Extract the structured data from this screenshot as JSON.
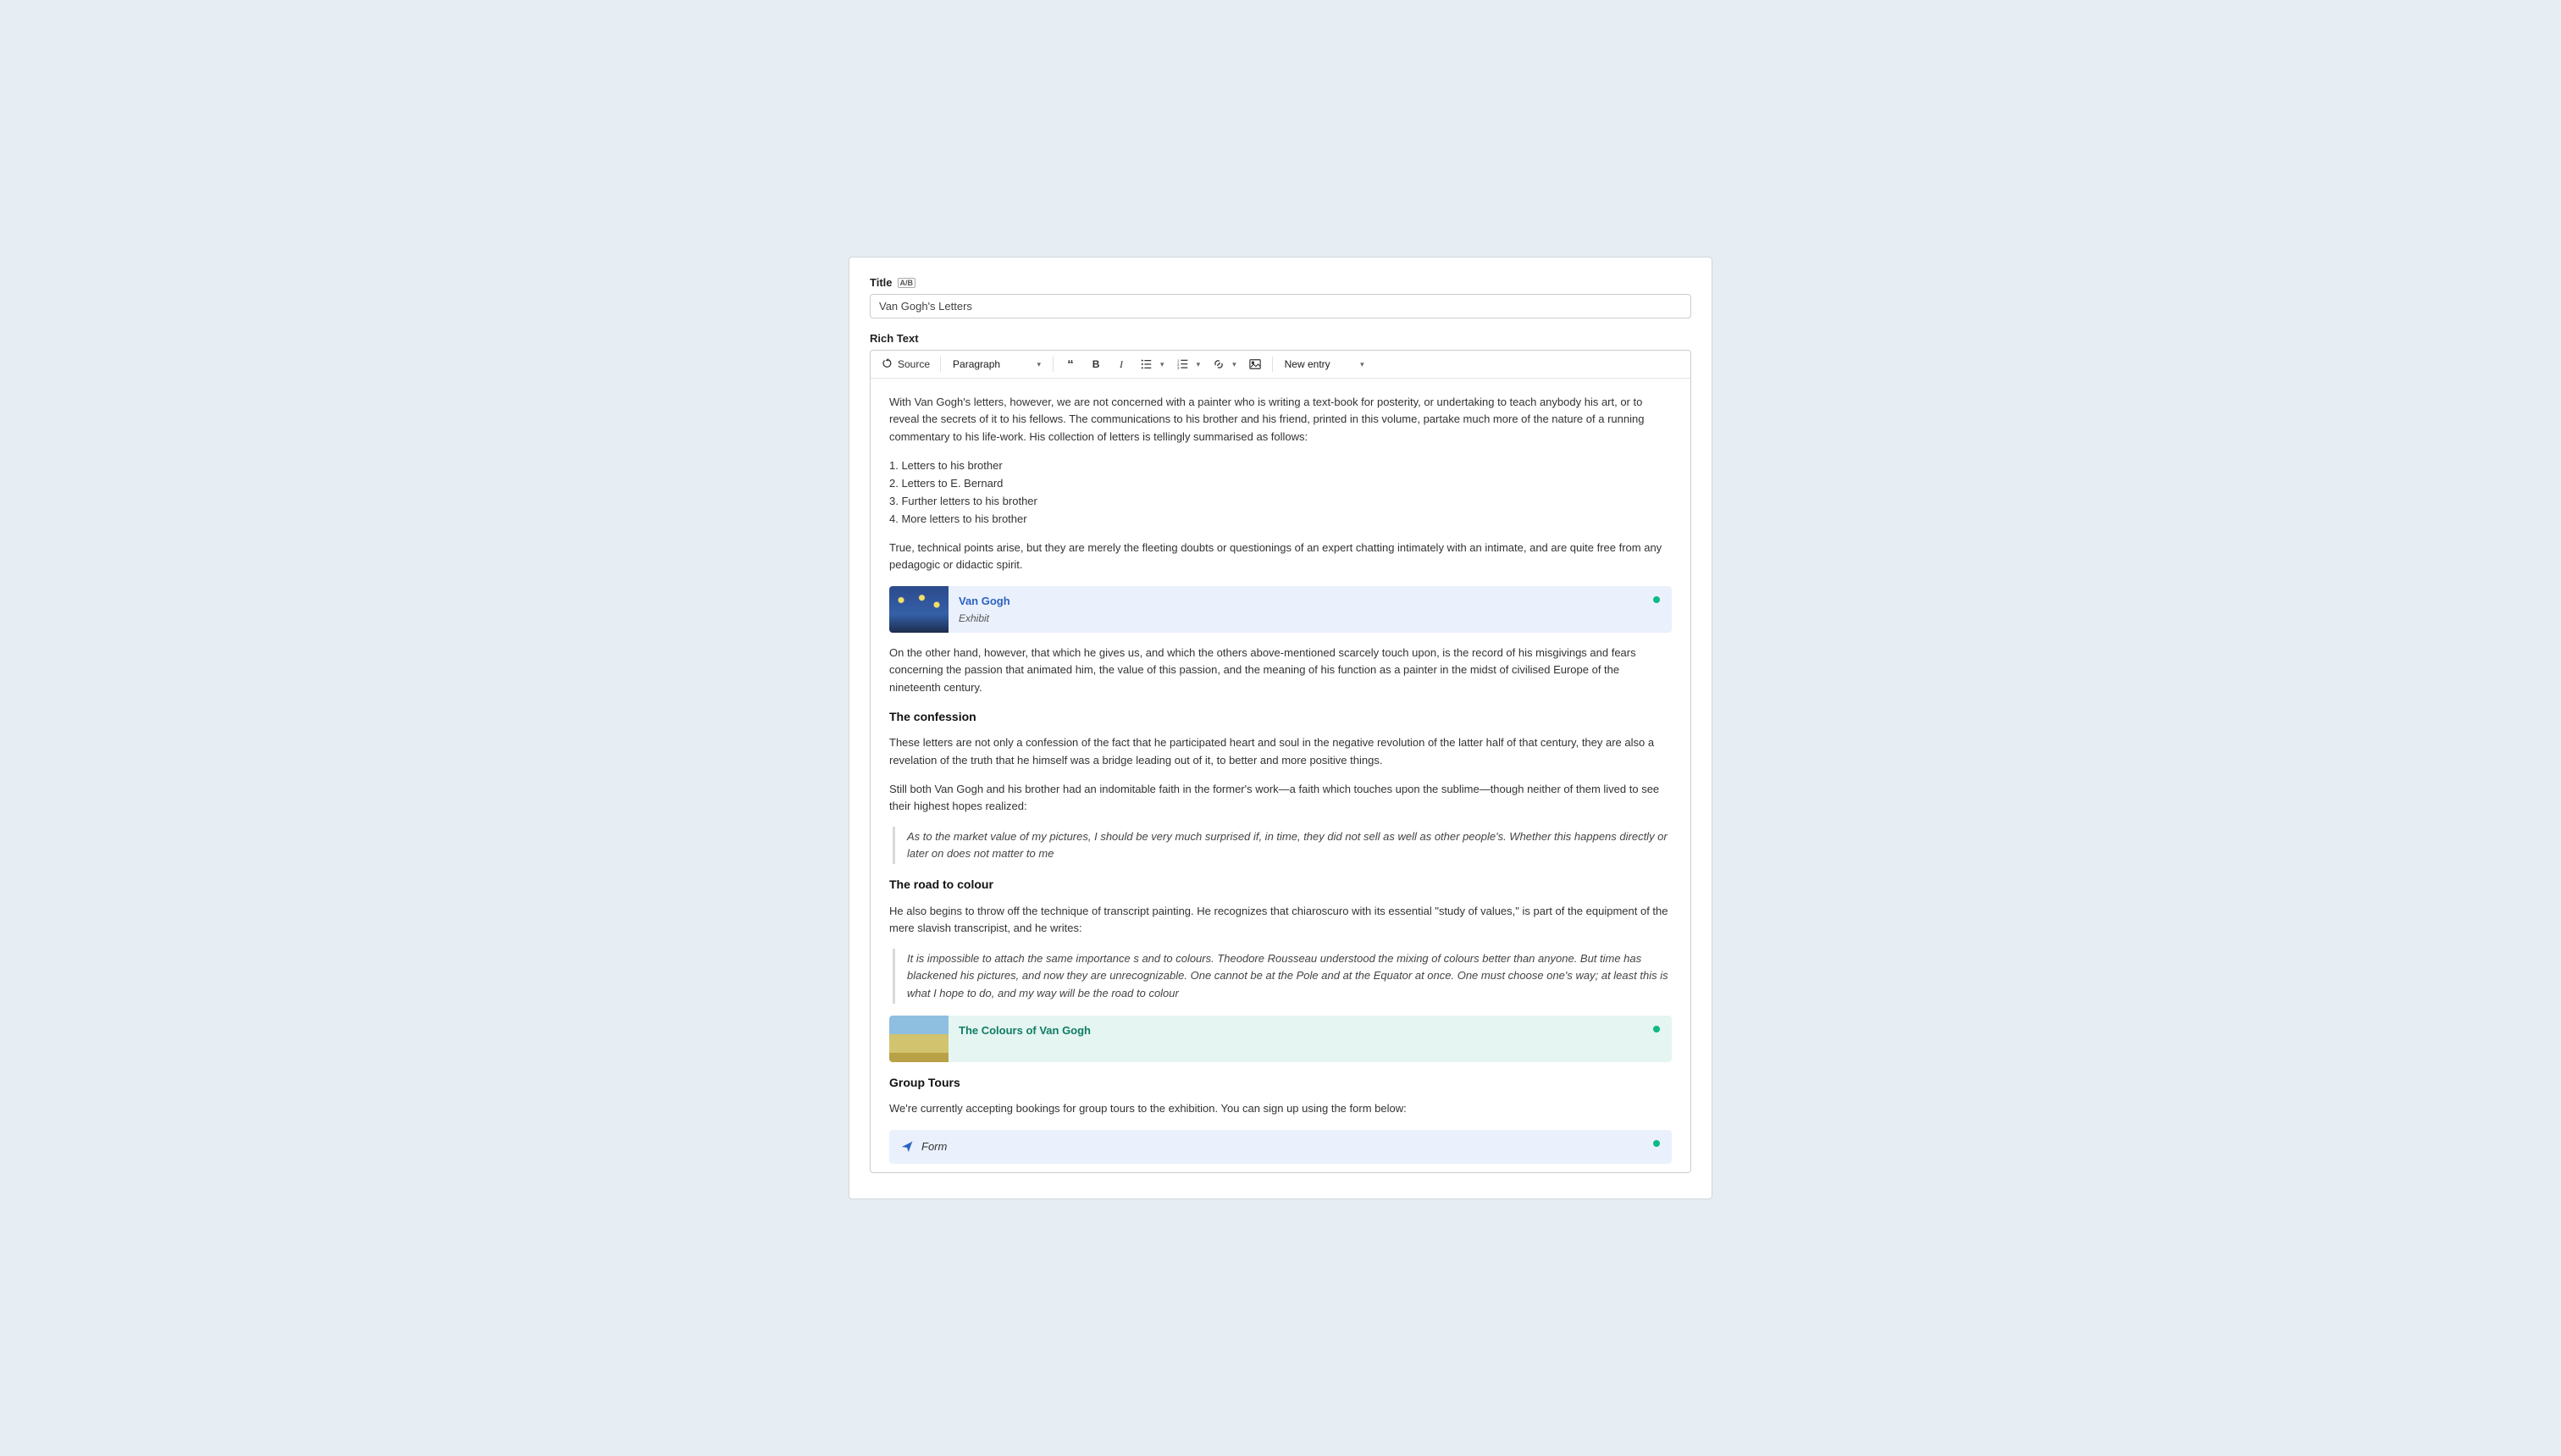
{
  "fields": {
    "title_label": "Title",
    "title_badge": "A/B",
    "title_value": "Van Gogh's Letters",
    "richtext_label": "Rich Text"
  },
  "toolbar": {
    "source": "Source",
    "paragraph": "Paragraph",
    "new_entry": "New entry"
  },
  "body": {
    "p1": "With Van Gogh's letters, however, we are not concerned with a painter who is writing a text-book for posterity, or undertaking to teach anybody his art, or to reveal the secrets of it to his fellows. The communications to his brother and his friend, printed in this volume, partake much more of the nature of a running commentary to his life-work. His collection of letters is tellingly summarised as follows:",
    "list": [
      "1. Letters to his brother",
      "2. Letters to E. Bernard",
      "3. Further letters to his brother",
      "4. More letters to his brother"
    ],
    "p2": "True, technical points arise, but they are merely the fleeting doubts or questionings of an expert chatting intimately with an intimate, and are quite free from any pedagogic or didactic spirit.",
    "embed1": {
      "title": "Van Gogh",
      "type": "Exhibit"
    },
    "p3": "On the other hand, however, that which he gives us, and which the others above-mentioned scarcely touch upon, is the record of his misgivings and fears concerning the passion that animated him, the value of this passion, and the meaning of his function as a painter in the midst of civilised Europe of the nineteenth century.",
    "h1": "The confession",
    "p4": "These letters are not only a confession of the fact that he participated heart and soul in the negative revolution of the latter half of that century, they are also a revelation of the truth that he himself was a bridge leading out of it, to better and more positive things.",
    "p5": "Still both Van Gogh and his brother had an indomitable faith in the former's work—a faith which touches upon the sublime—though neither of them lived to see their highest hopes realized:",
    "q1": "As to the market value of my pictures, I should be very much surprised if, in time, they did not sell as well as other people's. Whether this happens directly or later on does not matter to me",
    "h2": "The road to colour",
    "p6": "He also begins to throw off the technique of transcript painting. He recognizes that chiaroscuro with its essential \"study of values,\" is part of the equipment of the mere slavish transcripist, and he writes:",
    "q2": "It is impossible to attach the same importance                         s and to colours. Theodore Rousseau understood the mixing of colours better than anyone. But time has blackened his pictures, and now they are unrecognizable. One cannot be at the Pole and at the Equator at once. One must choose one's way; at least this is what I hope to do, and my way will be the road to colour",
    "embed2": {
      "title": "The Colours of Van Gogh"
    },
    "h3": "Group Tours",
    "p7": "We're currently accepting bookings for group tours to the exhibition. You can sign up using the form below:",
    "embed3": {
      "label": "Form"
    }
  }
}
